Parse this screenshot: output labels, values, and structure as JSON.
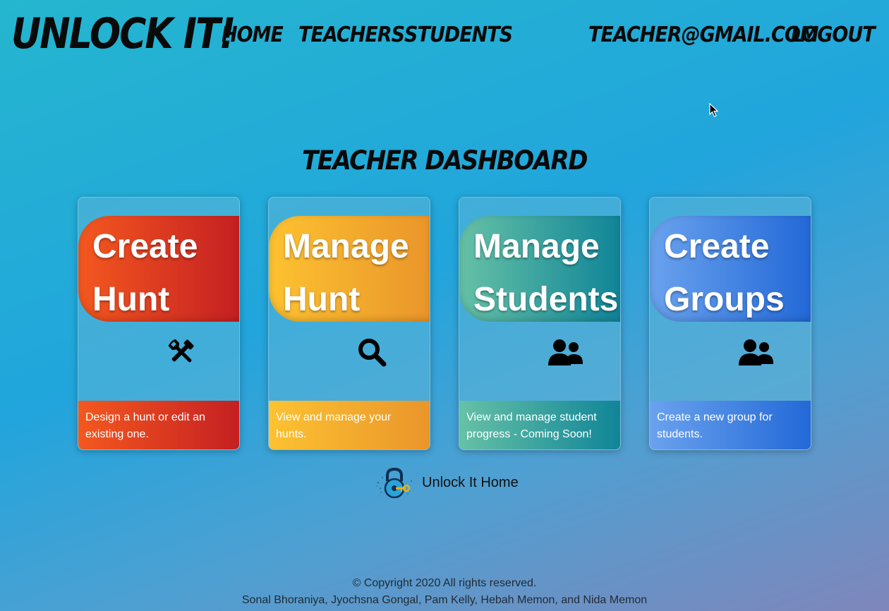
{
  "header": {
    "brand": "UNLOCK IT!",
    "nav": [
      {
        "label": "HOME"
      },
      {
        "label": "TEACHERS"
      },
      {
        "label": "STUDENTS"
      }
    ],
    "user_email": "TEACHER@GMAIL.COM",
    "logout_label": "LOGOUT"
  },
  "main": {
    "title": "TEACHER DASHBOARD",
    "cards": [
      {
        "title_line1": "Create",
        "title_line2": "Hunt",
        "description": "Design a hunt or edit an existing one.",
        "icon": "tools-icon",
        "colors": [
          "#f4581f",
          "#c41f22"
        ]
      },
      {
        "title_line1": "Manage",
        "title_line2": "Hunt",
        "description": "View and manage your hunts.",
        "icon": "search-icon",
        "colors": [
          "#fdc231",
          "#e9952a"
        ]
      },
      {
        "title_line1": "Manage",
        "title_line2": "Students",
        "description": "View and manage student progress - Coming Soon!",
        "icon": "users-icon",
        "colors": [
          "#66c1a6",
          "#0f8498"
        ]
      },
      {
        "title_line1": "Create",
        "title_line2": "Groups",
        "description": "Create a new group for students.",
        "icon": "users-icon",
        "colors": [
          "#6aa2ee",
          "#2268d7"
        ]
      }
    ],
    "home_link": {
      "label": "Unlock It Home",
      "icon": "padlock-logo-icon"
    }
  },
  "footer": {
    "copyright": "© Copyright 2020 All rights reserved.",
    "authors": "Sonal Bhoraniya, Jyochsna Gongal, Pam Kelly, Hebah Memon, and Nida Memon"
  }
}
